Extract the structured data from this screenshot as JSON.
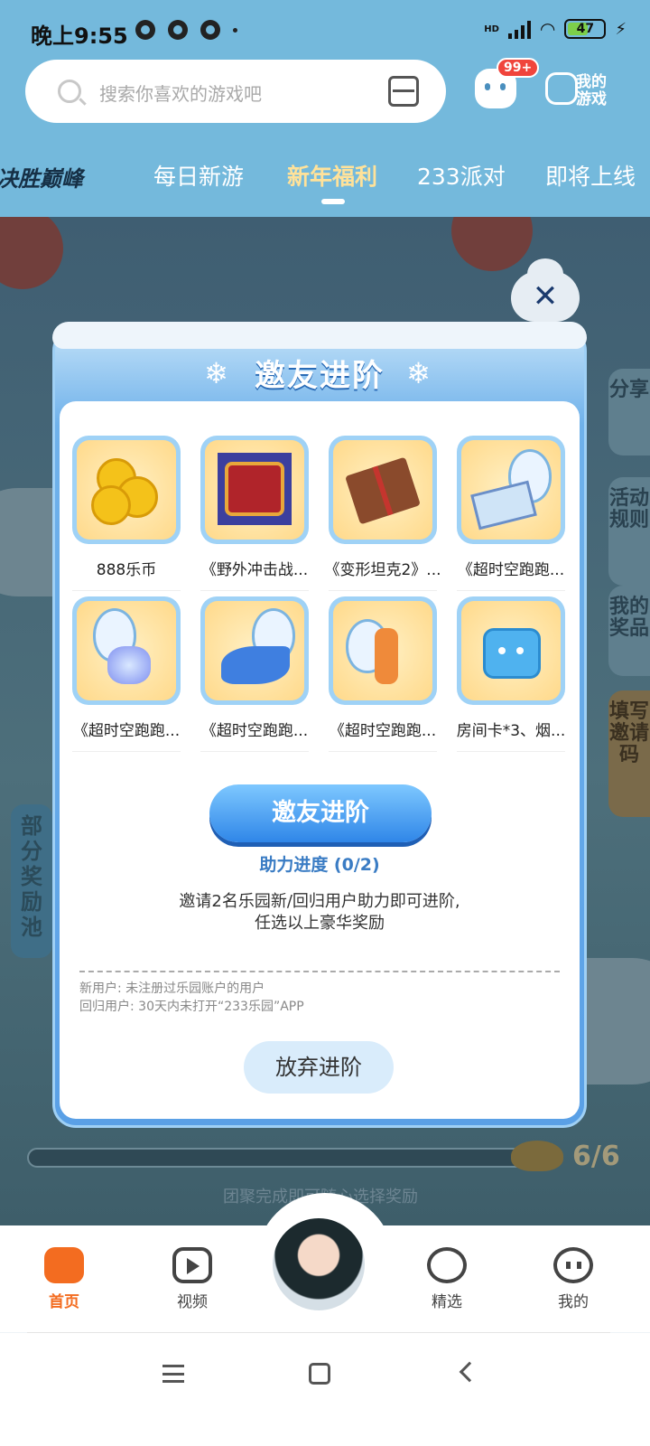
{
  "status_bar": {
    "time": "晚上9:55",
    "battery": "47",
    "network": "HD"
  },
  "search": {
    "placeholder": "搜索你喜欢的游戏吧"
  },
  "header": {
    "message_badge": "99+",
    "my_games_label": "我的游戏"
  },
  "tabs": [
    {
      "label": "决胜巅峰"
    },
    {
      "label": "每日新游"
    },
    {
      "label": "新年福利",
      "active": true
    },
    {
      "label": "233派对"
    },
    {
      "label": "即将上线"
    }
  ],
  "side_tabs": [
    "分享",
    "活动规则",
    "我的奖品",
    "填写邀请码"
  ],
  "left_tab": "部分奖励池",
  "background": {
    "progress_count": "6/6",
    "caption": "团聚完成即可随心选择奖励"
  },
  "modal": {
    "title": "邀友进阶",
    "rewards": [
      {
        "label": "888乐币"
      },
      {
        "label": "《野外冲击战..."
      },
      {
        "label": "《变形坦克2》..."
      },
      {
        "label": "《超时空跑跑..."
      },
      {
        "label": "《超时空跑跑..."
      },
      {
        "label": "《超时空跑跑..."
      },
      {
        "label": "《超时空跑跑..."
      },
      {
        "label": "房间卡*3、烟..."
      }
    ],
    "cta_label": "邀友进阶",
    "progress_text": "助力进度 (0/2)",
    "description_line1": "邀请2名乐园新/回归用户助力即可进阶,",
    "description_line2": "任选以上豪华奖励",
    "note_line1": "新用户: 未注册过乐园账户的用户",
    "note_line2": "回归用户: 30天内未打开“233乐园”APP",
    "giveup_label": "放弃进阶",
    "close_symbol": "✕"
  },
  "bottom_nav": [
    {
      "label": "首页",
      "icon": "gamepad-icon",
      "active": true
    },
    {
      "label": "视频",
      "icon": "play-icon"
    },
    {
      "label": "精选",
      "icon": "heart-icon"
    },
    {
      "label": "我的",
      "icon": "face-icon"
    }
  ]
}
